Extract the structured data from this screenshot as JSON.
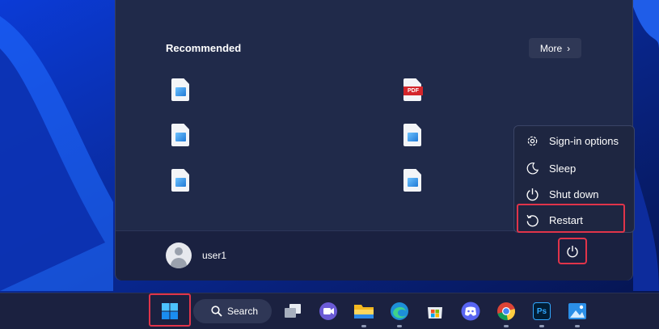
{
  "start_menu": {
    "recommended_title": "Recommended",
    "more_label": "More",
    "user": {
      "name": "user1"
    }
  },
  "recommended_items": [
    {
      "type": "image-file",
      "icon": "image-file-icon"
    },
    {
      "type": "pdf-file",
      "icon": "pdf-file-icon",
      "badge": "PDF"
    },
    {
      "type": "image-file",
      "icon": "image-file-icon"
    },
    {
      "type": "image-file",
      "icon": "image-file-icon"
    },
    {
      "type": "image-file",
      "icon": "image-file-icon"
    },
    {
      "type": "image-file",
      "icon": "image-file-icon"
    }
  ],
  "power_menu": {
    "items": [
      {
        "label": "Sign-in options",
        "icon": "gear-icon"
      },
      {
        "label": "Sleep",
        "icon": "moon-icon"
      },
      {
        "label": "Shut down",
        "icon": "power-icon"
      },
      {
        "label": "Restart",
        "icon": "restart-icon"
      }
    ]
  },
  "taskbar": {
    "search_label": "Search",
    "apps": [
      "task-view",
      "teams-meet",
      "file-explorer",
      "edge",
      "microsoft-store",
      "discord",
      "chrome",
      "photoshop",
      "photos"
    ],
    "photoshop_label": "Ps"
  },
  "colors": {
    "highlight": "#e0344a",
    "menu_bg": "#202a4a",
    "taskbar_bg": "#1b2140"
  }
}
